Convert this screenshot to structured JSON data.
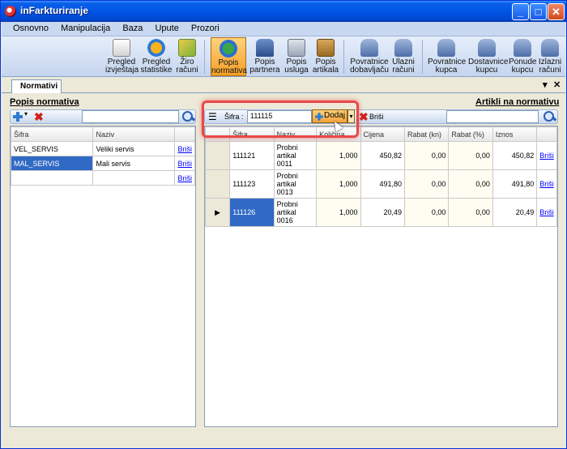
{
  "window": {
    "title": "inFarkturiranje"
  },
  "menu": [
    "Osnovno",
    "Manipulacija",
    "Baza",
    "Upute",
    "Prozori"
  ],
  "ribbon": [
    {
      "label": "Pregled izvještaja",
      "icon": "report-icon"
    },
    {
      "label": "Pregled statistike",
      "icon": "chart-icon"
    },
    {
      "label": "Žiro računi",
      "icon": "money-icon"
    },
    {
      "label": "Popis normativa",
      "icon": "globe-icon",
      "active": true
    },
    {
      "label": "Popis partnera",
      "icon": "partners-icon"
    },
    {
      "label": "Popis usluga",
      "icon": "services-icon"
    },
    {
      "label": "Popis artikala",
      "icon": "articles-icon"
    },
    {
      "label": "Povratnice dobavljaču",
      "icon": "truck-icon"
    },
    {
      "label": "Ulazni računi",
      "icon": "truck-icon"
    },
    {
      "label": "Povratnice kupca",
      "icon": "truck-icon"
    },
    {
      "label": "Dostavnice kupcu",
      "icon": "truck-icon"
    },
    {
      "label": "Ponude kupcu",
      "icon": "truck-icon"
    },
    {
      "label": "Izlazni računi",
      "icon": "truck-icon"
    }
  ],
  "tab": {
    "label": "Normativi"
  },
  "left": {
    "title": "Popis normativa",
    "columns": [
      "Šifra",
      "Naziv"
    ],
    "rows": [
      {
        "sifra": "VEL_SERVIS",
        "naziv": "Veliki servis",
        "action": "Briši"
      },
      {
        "sifra": "MAL_SERVIS",
        "naziv": "Mali servis",
        "action": "Briši"
      },
      {
        "sifra": "",
        "naziv": "",
        "action": "Briši"
      }
    ]
  },
  "right": {
    "title": "Artikli na normativu",
    "sifra_label": "Šifra :",
    "sifra_value": "111115",
    "add_label": "Dodaj",
    "delete_label": "Briši",
    "columns": [
      "Šifra",
      "Naziv",
      "Količina",
      "Cijena",
      "Rabat (kn)",
      "Rabat (%)",
      "Iznos"
    ],
    "rows": [
      {
        "sifra": "111121",
        "naziv": "Probni artikal 0011",
        "kolicina": "1,000",
        "cijena": "450,82",
        "rabat_kn": "0,00",
        "rabat_pct": "0,00",
        "iznos": "450,82",
        "action": "Briši"
      },
      {
        "sifra": "111123",
        "naziv": "Probni artikal 0013",
        "kolicina": "1,000",
        "cijena": "491,80",
        "rabat_kn": "0,00",
        "rabat_pct": "0,00",
        "iznos": "491,80",
        "action": "Briši"
      },
      {
        "sifra": "111126",
        "naziv": "Probni artikal 0016",
        "kolicina": "1,000",
        "cijena": "20,49",
        "rabat_kn": "0,00",
        "rabat_pct": "0,00",
        "iznos": "20,49",
        "action": "Briši"
      }
    ]
  }
}
